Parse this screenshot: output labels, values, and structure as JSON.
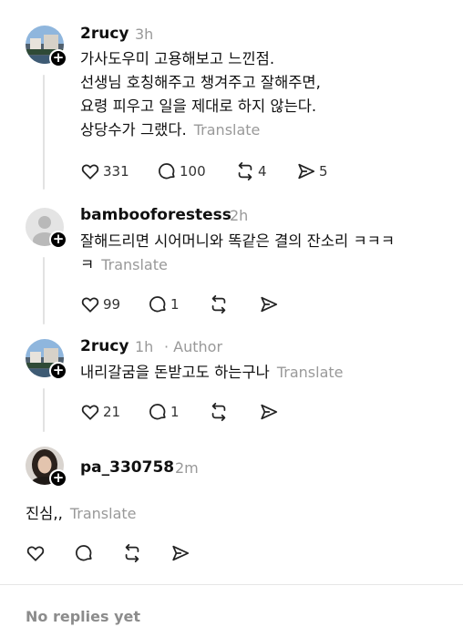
{
  "posts": [
    {
      "username": "2rucy",
      "time": "3h",
      "lines": [
        "가사도우미 고용해보고 느낀점.",
        "선생님 호칭해주고 챙겨주고 잘해주면,",
        "요령 피우고 일을 제대로 하지 않는다.",
        "상당수가 그랬다."
      ],
      "translate": "Translate",
      "likes": "331",
      "replies": "100",
      "reposts": "4",
      "shares": "5"
    },
    {
      "username": "bambooforestess",
      "time": "2h",
      "lines": [
        "잘해드리면 시어머니와 똑같은 결의 잔소리 ㅋㅋㅋ",
        "ㅋ"
      ],
      "translate": "Translate",
      "likes": "99",
      "replies": "1"
    },
    {
      "username": "2rucy",
      "time": "1h",
      "author_tag": "· Author",
      "lines": [
        "내리갈굼을 돈받고도 하는구나"
      ],
      "translate": "Translate",
      "likes": "21",
      "replies": "1"
    },
    {
      "username": "pa_330758",
      "time": "2m",
      "lines": [
        "진심,,"
      ],
      "translate": "Translate"
    }
  ],
  "footer": {
    "no_replies": "No replies yet"
  },
  "icons": [
    "heart-icon",
    "comment-icon",
    "repost-icon",
    "share-icon",
    "plus-icon"
  ]
}
